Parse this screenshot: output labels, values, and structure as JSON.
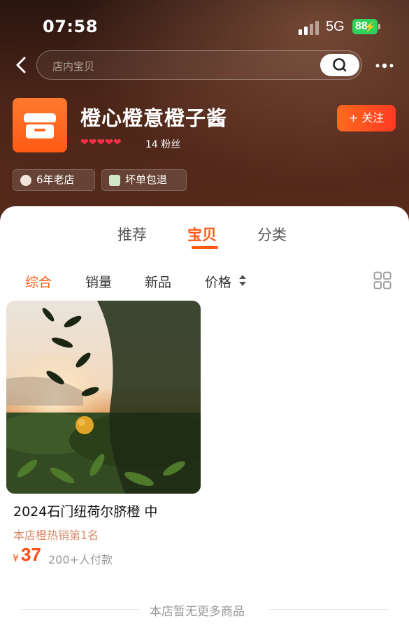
{
  "status_bar": {
    "time": "07:58",
    "network": "5G",
    "battery": "88"
  },
  "search": {
    "placeholder": "店内宝贝"
  },
  "shop": {
    "name": "橙心橙意橙子酱",
    "hearts": "❤❤❤❤❤",
    "fans": "14 粉丝",
    "follow_label": "+ 关注",
    "badges": [
      {
        "label": "6年老店",
        "icon": "shop-age-icon"
      },
      {
        "label": "坏单包退",
        "icon": "refund-icon"
      }
    ]
  },
  "tabs": [
    {
      "label": "推荐",
      "active": false
    },
    {
      "label": "宝贝",
      "active": true
    },
    {
      "label": "分类",
      "active": false
    }
  ],
  "filters": [
    {
      "label": "综合",
      "active": true
    },
    {
      "label": "销量",
      "active": false
    },
    {
      "label": "新品",
      "active": false
    },
    {
      "label": "价格",
      "active": false
    }
  ],
  "product": {
    "title": "2024石门纽荷尔脐橙 中",
    "rank": "本店橙热销第1名",
    "price_symbol": "¥",
    "price": "37",
    "paid": "200+人付款"
  },
  "end_text": "本店暂无更多商品",
  "colors": {
    "accent": "#ff5a14",
    "hero_dark": "#3a1d14",
    "battery": "#2fd15a"
  }
}
